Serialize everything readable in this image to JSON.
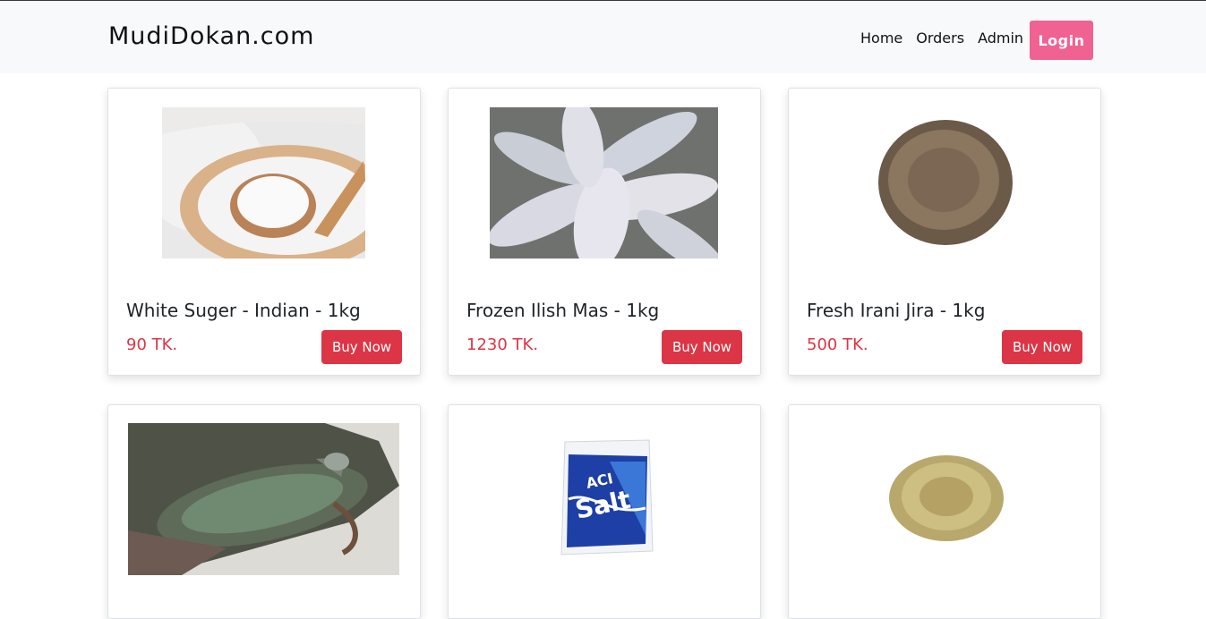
{
  "brand": "MudiDokan.com",
  "nav": {
    "home": "Home",
    "orders": "Orders",
    "admin": "Admin",
    "login": "Login"
  },
  "products": [
    {
      "title": "White Suger - Indian - 1kg",
      "price": "90 TK.",
      "buy": "Buy Now"
    },
    {
      "title": "Frozen Ilish Mas - 1kg",
      "price": "1230 TK.",
      "buy": "Buy Now"
    },
    {
      "title": "Fresh Irani Jira - 1kg",
      "price": "500 TK.",
      "buy": "Buy Now"
    }
  ],
  "colors": {
    "accent": "#dc3545",
    "login": "#f06292",
    "navbar": "#f8f9fa"
  }
}
